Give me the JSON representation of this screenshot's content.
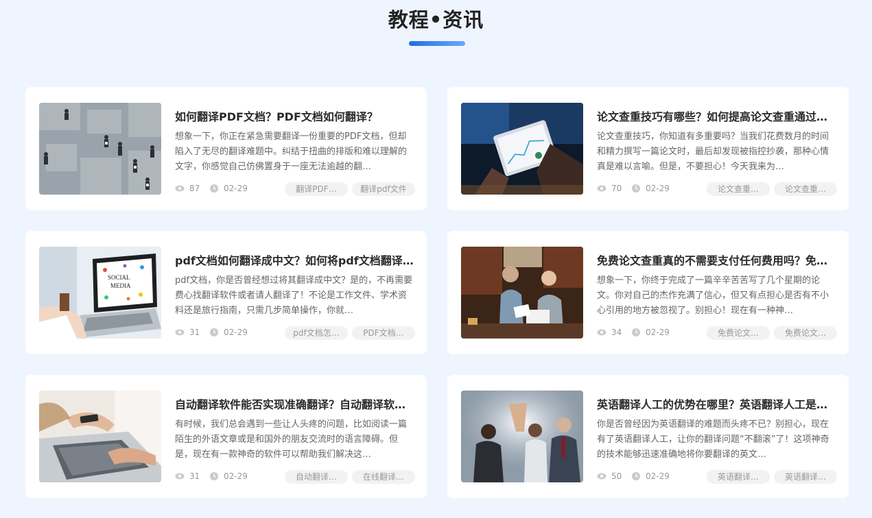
{
  "section": {
    "title": "教程•资讯"
  },
  "articles": [
    {
      "title": "如何翻译PDF文档？PDF文档如何翻译？",
      "description": "想象一下，你正在紧急需要翻译一份重要的PDF文档，但却陷入了无尽的翻译难题中。纠结于扭曲的排版和难以理解的文字，你感觉自己仿佛置身于一座无法逾越的翻…",
      "views": "87",
      "date": "02-29",
      "tags": [
        "翻译PDF…",
        "翻译pdf文件"
      ],
      "image": "office-crowd-photo"
    },
    {
      "title": "论文查重技巧有哪些？如何提高论文查重通过…",
      "description": "论文查重技巧，你知道有多重要吗？当我们花费数月的时间和精力撰写一篇论文时，最后却发现被指控抄袭，那种心情真是难以言喻。但是，不要担心！今天我来为…",
      "views": "70",
      "date": "02-29",
      "tags": [
        "论文查重…",
        "论文查重…"
      ],
      "image": "tablet-chart-photo"
    },
    {
      "title": "pdf文档如何翻译成中文？如何将pdf文档翻译…",
      "description": "pdf文档，你是否曾经想过将其翻译成中文？是的，不再需要费心找翻译软件或者请人翻译了！不论是工作文件、学术资料还是旅行指南，只需几步简单操作，你就…",
      "views": "31",
      "date": "02-29",
      "tags": [
        "pdf文档怎…",
        "PDF文档…"
      ],
      "image": "laptop-social-media-photo",
      "screen_text": [
        "SOCIAL",
        "MEDIA"
      ]
    },
    {
      "title": "免费论文查重真的不需要支付任何费用吗？免…",
      "description": "想象一下，你终于完成了一篇辛辛苦苦写了几个星期的论文。你对自己的杰作充满了信心，但又有点担心是否有不小心引用的地方被忽视了。别担心！现在有一种神…",
      "views": "34",
      "date": "02-29",
      "tags": [
        "免费论文…",
        "免费论文…"
      ],
      "image": "cafe-colleagues-photo"
    },
    {
      "title": "自动翻译软件能否实现准确翻译？自动翻译软…",
      "description": "有时候，我们总会遇到一些让人头疼的问题，比如阅读一篇陌生的外语文章或是和国外的朋友交流时的语言障碍。但是，现在有一款神奇的软件可以帮助我们解决这…",
      "views": "31",
      "date": "02-29",
      "tags": [
        "自动翻译…",
        "在线翻译…"
      ],
      "image": "phone-laptop-hands-photo"
    },
    {
      "title": "英语翻译人工的优势在哪里？英语翻译人工是…",
      "description": "你是否曾经因为英语翻译的难题而头疼不已？别担心，现在有了英语翻译人工，让你的翻译问题“不翻滚”了！这项神奇的技术能够迅速准确地将你要翻译的英文…",
      "views": "50",
      "date": "02-29",
      "tags": [
        "英语翻译…",
        "英语翻译…"
      ],
      "image": "team-high-five-photo"
    }
  ],
  "colors": {
    "background": "#eef5ff",
    "accent": "#1f6fe0",
    "card": "#ffffff",
    "tag_bg": "#f1f2f4",
    "meta_text": "#999999"
  },
  "icons": {
    "views": "eye-icon",
    "date": "clock-icon"
  }
}
